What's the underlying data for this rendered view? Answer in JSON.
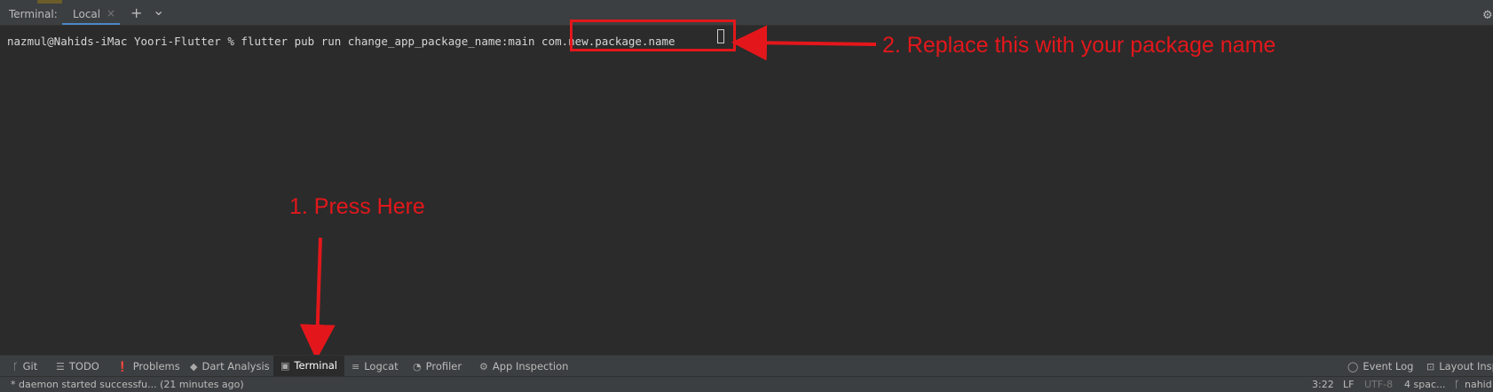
{
  "terminal": {
    "title": "Terminal:",
    "tab_label": "Local",
    "tab_close": "×",
    "add_icon": "+",
    "menu_icon": "⌄",
    "settings_icon": "⚙",
    "command_line": "nazmul@Nahids-iMac Yoori-Flutter % flutter pub run change_app_package_name:main com.new.package.name"
  },
  "annotations": {
    "step1": "1. Press Here",
    "step2": "2. Replace this with your package name",
    "accent_color": "#e3171b"
  },
  "toolwindows": [
    {
      "icon": "git-icon",
      "glyph": "ᚴ",
      "label": "Git"
    },
    {
      "icon": "todo-list-icon",
      "glyph": "☰",
      "label": "TODO"
    },
    {
      "icon": "problems-icon",
      "glyph": "❗",
      "label": "Problems"
    },
    {
      "icon": "dart-icon",
      "glyph": "◆",
      "label": "Dart Analysis"
    },
    {
      "icon": "terminal-icon",
      "glyph": "▣",
      "label": "Terminal"
    },
    {
      "icon": "logcat-icon",
      "glyph": "≡",
      "label": "Logcat"
    },
    {
      "icon": "profiler-icon",
      "glyph": "◔",
      "label": "Profiler"
    },
    {
      "icon": "app-inspection-icon",
      "glyph": "⚙",
      "label": "App Inspection"
    },
    {
      "icon": "event-log-icon",
      "glyph": "◯",
      "label": "Event Log"
    },
    {
      "icon": "layout-inspector-icon",
      "glyph": "⊡",
      "label": "Layout Insp"
    }
  ],
  "status": {
    "message": "* daemon started successfu... (21 minutes ago)",
    "position": "3:22",
    "line_sep": "LF",
    "encoding": "UTF-8",
    "indent": "4 spac...",
    "branch_icon": "ᚴ",
    "branch": "nahid"
  }
}
